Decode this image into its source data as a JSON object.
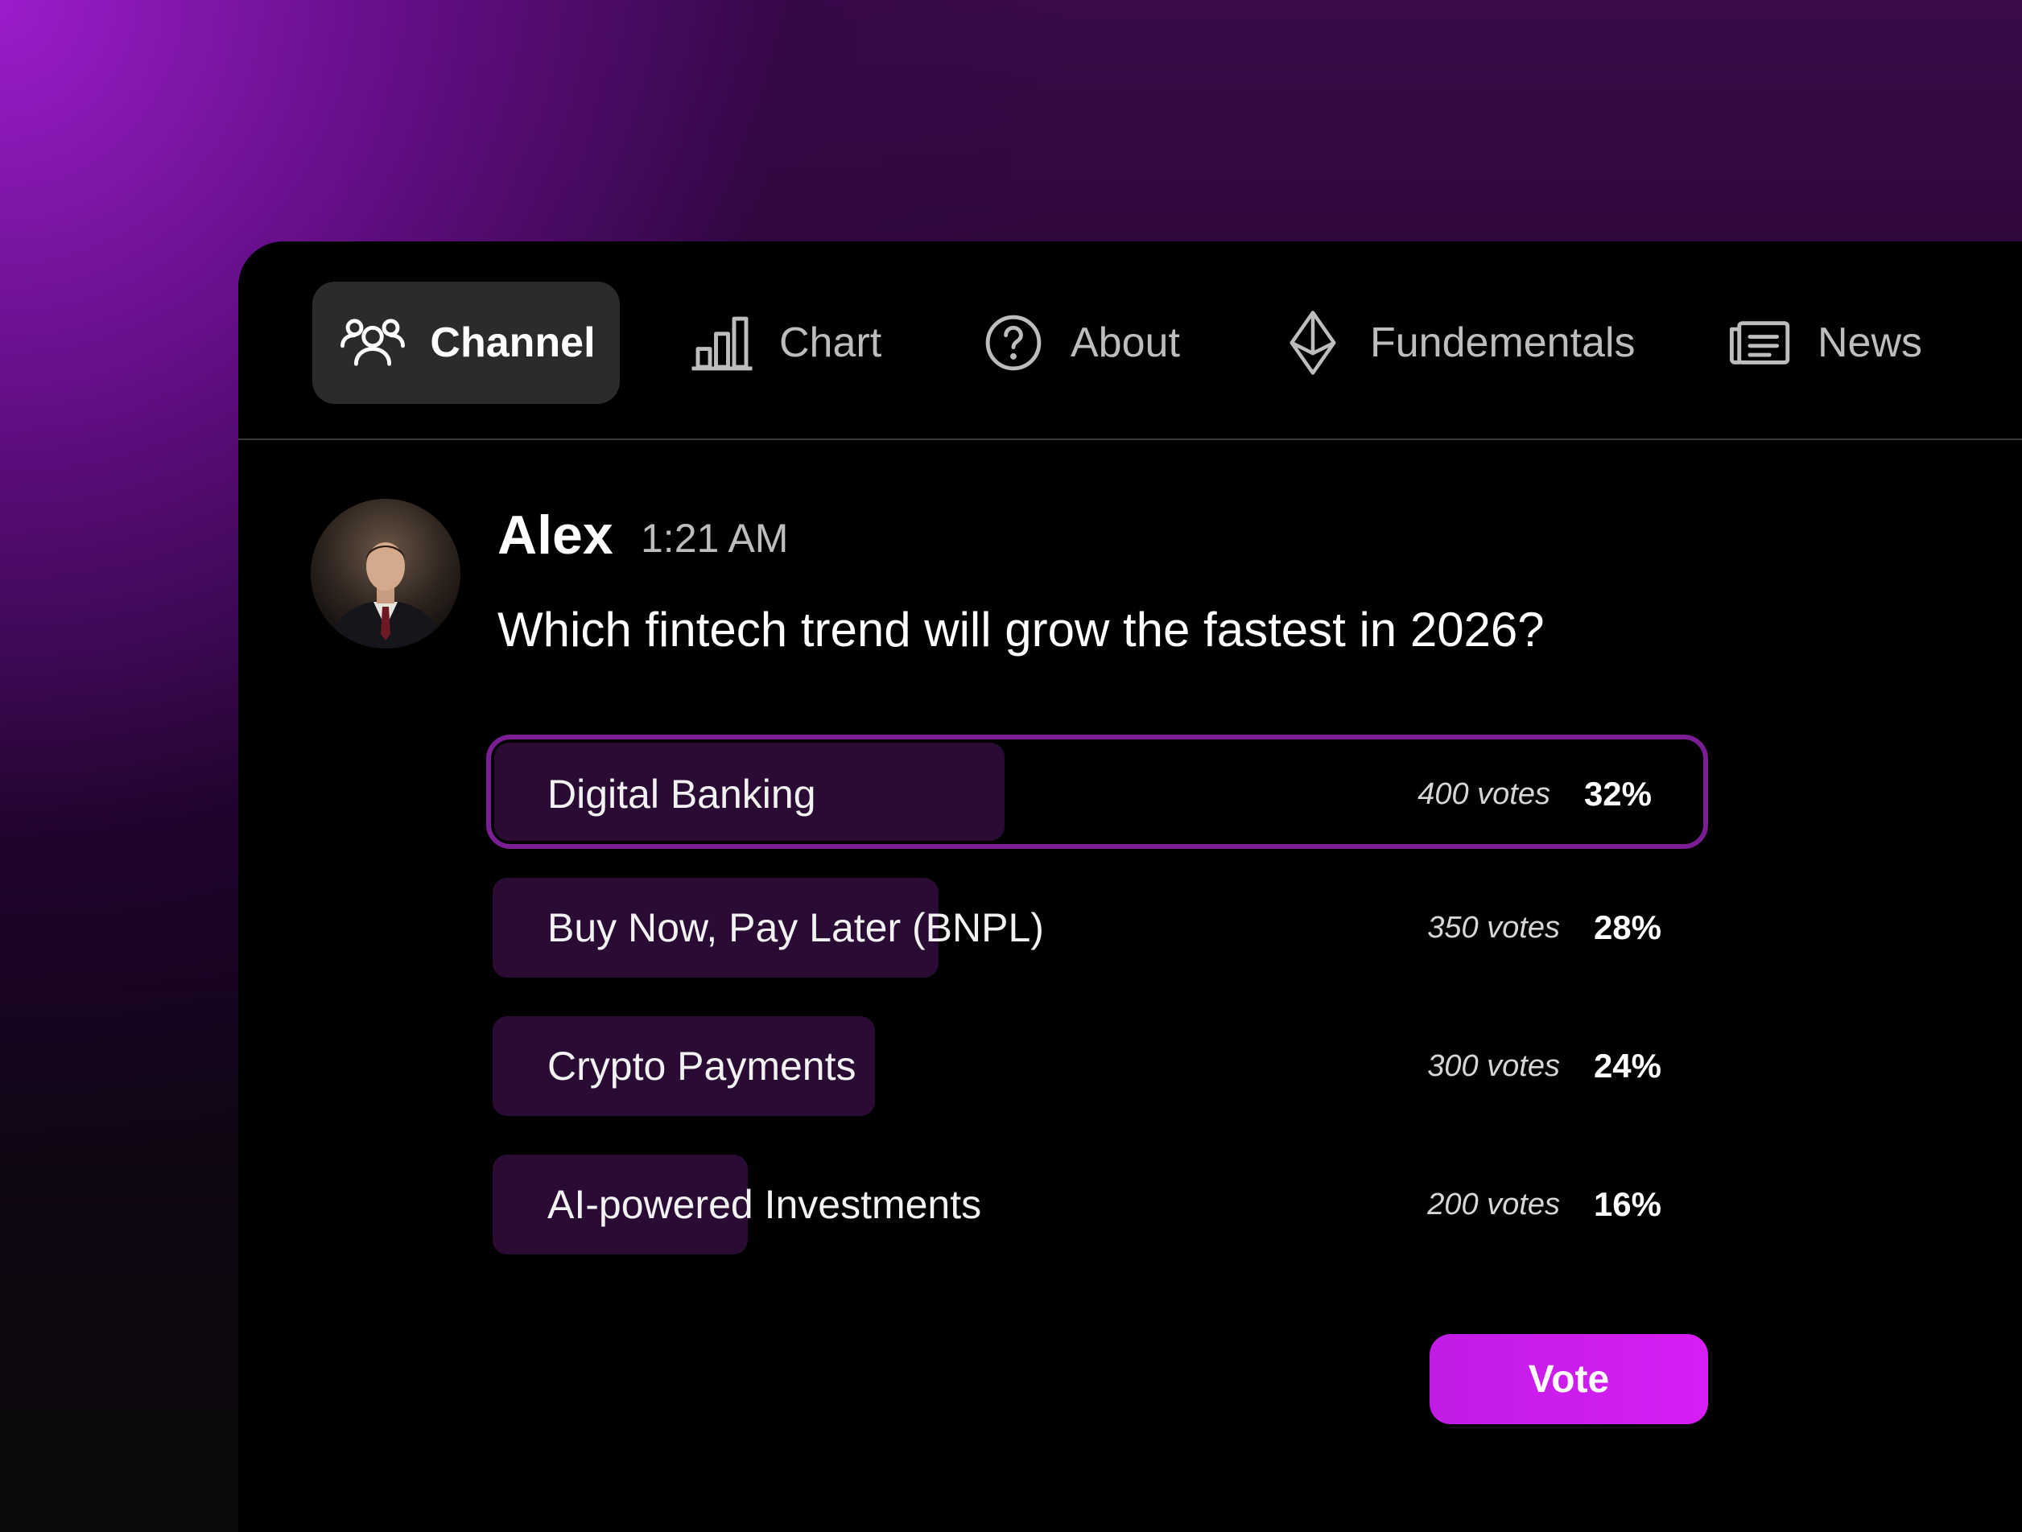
{
  "tabs": [
    {
      "label": "Channel",
      "icon": "users-icon",
      "active": true
    },
    {
      "label": "Chart",
      "icon": "bar-chart-icon",
      "active": false
    },
    {
      "label": "About",
      "icon": "question-circle-icon",
      "active": false
    },
    {
      "label": "Fundementals",
      "icon": "ethereum-icon",
      "active": false
    },
    {
      "label": "News",
      "icon": "newspaper-icon",
      "active": false
    }
  ],
  "message": {
    "author": "Alex",
    "time": "1:21 AM",
    "question": "Which fintech trend will grow the fastest in 2026?"
  },
  "poll": {
    "options": [
      {
        "label": "Digital Banking",
        "votes": "400 votes",
        "percent": "32%",
        "share": 0.32,
        "selected": true
      },
      {
        "label": "Buy Now, Pay Later (BNPL)",
        "votes": "350 votes",
        "percent": "28%",
        "share": 0.28,
        "selected": false
      },
      {
        "label": "Crypto Payments",
        "votes": "300 votes",
        "percent": "24%",
        "share": 0.24,
        "selected": false
      },
      {
        "label": "AI-powered Investments",
        "votes": "200 votes",
        "percent": "16%",
        "share": 0.16,
        "selected": false
      }
    ],
    "vote_label": "Vote"
  },
  "colors": {
    "accent": "#d01ef0",
    "selected_border": "#7a1e94",
    "bar_fill": "#2a0b33"
  }
}
